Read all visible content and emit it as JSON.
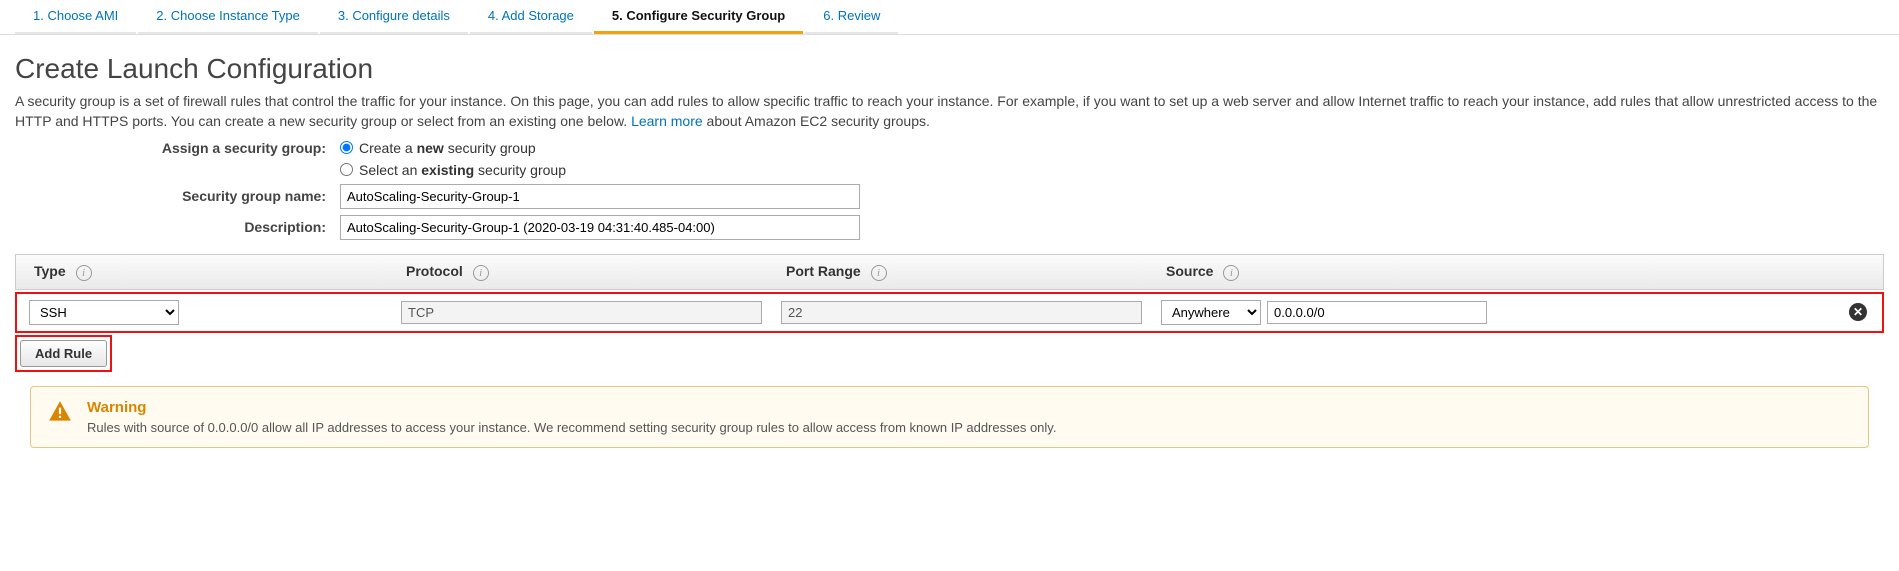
{
  "tabs": [
    {
      "label": "1. Choose AMI",
      "active": false
    },
    {
      "label": "2. Choose Instance Type",
      "active": false
    },
    {
      "label": "3. Configure details",
      "active": false
    },
    {
      "label": "4. Add Storage",
      "active": false
    },
    {
      "label": "5. Configure Security Group",
      "active": true
    },
    {
      "label": "6. Review",
      "active": false
    }
  ],
  "heading": "Create Launch Configuration",
  "description_pre": "A security group is a set of firewall rules that control the traffic for your instance. On this page, you can add rules to allow specific traffic to reach your instance. For example, if you want to set up a web server and allow Internet traffic to reach your instance, add rules that allow unrestricted access to the HTTP and HTTPS ports. You can create a new security group or select from an existing one below. ",
  "learn_more": "Learn more",
  "description_post": " about Amazon EC2 security groups.",
  "form": {
    "assign_label": "Assign a security group:",
    "radio_create_pre": "Create a ",
    "radio_create_bold": "new",
    "radio_create_post": " security group",
    "radio_select_pre": "Select an ",
    "radio_select_bold": "existing",
    "radio_select_post": " security group",
    "sg_name_label": "Security group name:",
    "sg_name_value": "AutoScaling-Security-Group-1",
    "desc_label": "Description:",
    "desc_value": "AutoScaling-Security-Group-1 (2020-03-19 04:31:40.485-04:00)"
  },
  "columns": {
    "type": "Type",
    "protocol": "Protocol",
    "port_range": "Port Range",
    "source": "Source"
  },
  "rule": {
    "type": "SSH",
    "protocol": "TCP",
    "port_range": "22",
    "source_mode": "Anywhere",
    "source_cidr": "0.0.0.0/0"
  },
  "add_rule": "Add Rule",
  "warning": {
    "title": "Warning",
    "text": "Rules with source of 0.0.0.0/0 allow all IP addresses to access your instance. We recommend setting security group rules to allow access from known IP addresses only."
  }
}
